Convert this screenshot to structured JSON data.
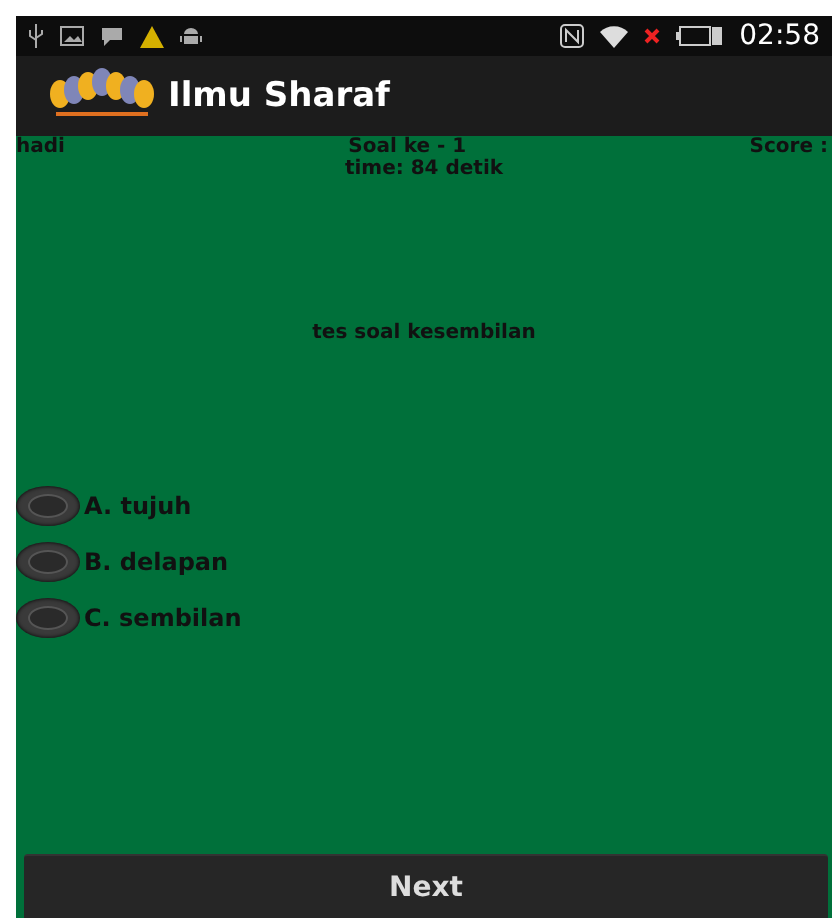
{
  "status_bar": {
    "time": "02:58"
  },
  "action_bar": {
    "title": "Ilmu Sharaf"
  },
  "quiz": {
    "user": "hadi",
    "question_number": "Soal ke - 1",
    "score": "Score :",
    "timer": "time: 84 detik",
    "question": "tes soal kesembilan",
    "options": [
      {
        "label": "A. tujuh",
        "selected": false
      },
      {
        "label": "B. delapan",
        "selected": false
      },
      {
        "label": "C. sembilan",
        "selected": false
      }
    ]
  },
  "next_button": "Next"
}
